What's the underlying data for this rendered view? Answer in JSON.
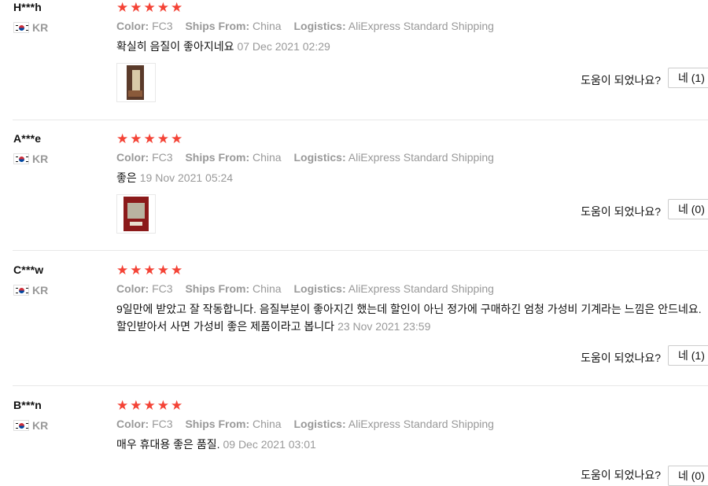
{
  "reviews": [
    {
      "user": "H***h",
      "country": "KR",
      "rating": 5,
      "stars": "★★★★★",
      "color_label": "Color:",
      "color": "FC3",
      "ships_label": "Ships From:",
      "ships": "China",
      "logistics_label": "Logistics:",
      "logistics": "AliExpress Standard Shipping",
      "text": "확실히 음질이 좋아지네요",
      "date": "07 Dec 2021 02:29",
      "helpful_label": "도움이 되었나요?",
      "helpful_button": "네 (1)"
    },
    {
      "user": "A***e",
      "country": "KR",
      "rating": 5,
      "stars": "★★★★★",
      "color_label": "Color:",
      "color": "FC3",
      "ships_label": "Ships From:",
      "ships": "China",
      "logistics_label": "Logistics:",
      "logistics": "AliExpress Standard Shipping",
      "text": "좋은",
      "date": "19 Nov 2021 05:24",
      "helpful_label": "도움이 되었나요?",
      "helpful_button": "네 (0)"
    },
    {
      "user": "C***w",
      "country": "KR",
      "rating": 5,
      "stars": "★★★★★",
      "color_label": "Color:",
      "color": "FC3",
      "ships_label": "Ships From:",
      "ships": "China",
      "logistics_label": "Logistics:",
      "logistics": "AliExpress Standard Shipping",
      "text": "9일만에 받았고 잘 작동합니다. 음질부분이 좋아지긴 했는데 할인이 아닌 정가에 구매하긴 엄청 가성비 기계라는 느낌은 안드네요. 할인받아서 사면 가성비 좋은 제품이라고 봅니다",
      "date": "23 Nov 2021 23:59",
      "helpful_label": "도움이 되었나요?",
      "helpful_button": "네 (1)"
    },
    {
      "user": "B***n",
      "country": "KR",
      "rating": 5,
      "stars": "★★★★★",
      "color_label": "Color:",
      "color": "FC3",
      "ships_label": "Ships From:",
      "ships": "China",
      "logistics_label": "Logistics:",
      "logistics": "AliExpress Standard Shipping",
      "text": "매우 휴대용 좋은 품질.",
      "date": "09 Dec 2021 03:01",
      "helpful_label": "도움이 되었나요?",
      "helpful_button": "네 (0)"
    }
  ],
  "colors": {
    "star": "#f44336",
    "muted": "#999999",
    "divider": "#e8e8e8"
  }
}
